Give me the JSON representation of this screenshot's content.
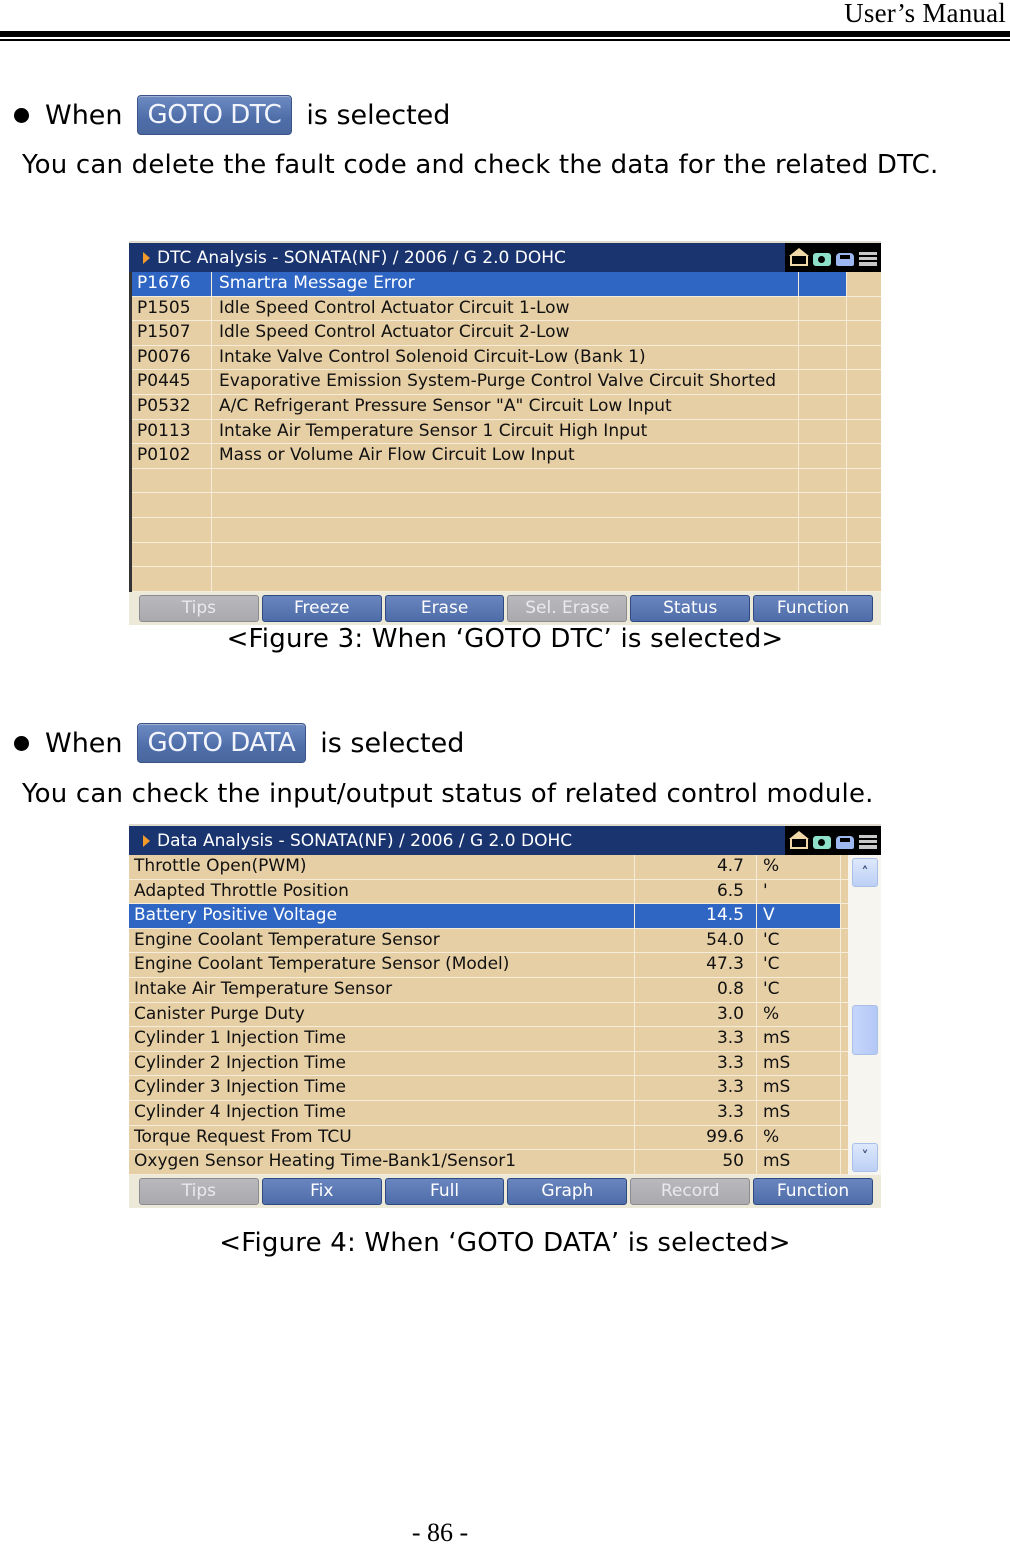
{
  "header": {
    "title": "User’s Manual"
  },
  "section_dtc": {
    "lead_before": "When",
    "button_label": "GOTO DTC",
    "lead_after": "is selected",
    "description": "You can delete the fault code and check the data for the related DTC.",
    "caption": "<Figure 3: When ‘GOTO DTC’ is selected>"
  },
  "dtc_screen": {
    "title": "DTC Analysis - SONATA(NF) / 2006 / G 2.0 DOHC",
    "icons": [
      "home-icon",
      "camera-icon",
      "car-icon",
      "menu-icon"
    ],
    "selected_index": 0,
    "rows": [
      {
        "code": "P1676",
        "description": "Smartra Message Error"
      },
      {
        "code": "P1505",
        "description": "Idle Speed Control Actuator Circuit 1-Low"
      },
      {
        "code": "P1507",
        "description": "Idle Speed Control Actuator Circuit 2-Low"
      },
      {
        "code": "P0076",
        "description": "Intake Valve Control Solenoid Circuit-Low (Bank 1)"
      },
      {
        "code": "P0445",
        "description": "Evaporative Emission System-Purge Control Valve Circuit Shorted"
      },
      {
        "code": "P0532",
        "description": "A/C Refrigerant Pressure Sensor \"A\" Circuit Low Input"
      },
      {
        "code": "P0113",
        "description": "Intake Air Temperature Sensor 1 Circuit High Input"
      },
      {
        "code": "P0102",
        "description": "Mass or Volume Air Flow Circuit Low Input"
      },
      {
        "code": "",
        "description": ""
      },
      {
        "code": "",
        "description": ""
      },
      {
        "code": "",
        "description": ""
      },
      {
        "code": "",
        "description": ""
      },
      {
        "code": "",
        "description": ""
      }
    ],
    "buttons": [
      {
        "label": "Tips",
        "enabled": false
      },
      {
        "label": "Freeze",
        "enabled": true
      },
      {
        "label": "Erase",
        "enabled": true
      },
      {
        "label": "Sel. Erase",
        "enabled": false
      },
      {
        "label": "Status",
        "enabled": true
      },
      {
        "label": "Function",
        "enabled": true
      }
    ]
  },
  "section_data": {
    "lead_before": "When",
    "button_label": "GOTO DATA",
    "lead_after": "is selected",
    "description": "You can check the input/output status of related control module.",
    "caption": "<Figure 4: When ‘GOTO DATA’ is selected>"
  },
  "data_screen": {
    "title": "Data Analysis - SONATA(NF) / 2006 / G 2.0 DOHC",
    "icons": [
      "home-icon",
      "camera-icon",
      "car-icon",
      "menu-icon"
    ],
    "selected_index": 2,
    "rows": [
      {
        "name": "Throttle Open(PWM)",
        "value": "4.7",
        "unit": "%"
      },
      {
        "name": "Adapted Throttle Position",
        "value": "6.5",
        "unit": "'"
      },
      {
        "name": "Battery Positive Voltage",
        "value": "14.5",
        "unit": "V"
      },
      {
        "name": "Engine Coolant Temperature Sensor",
        "value": "54.0",
        "unit": "'C"
      },
      {
        "name": "Engine Coolant Temperature Sensor (Model)",
        "value": "47.3",
        "unit": "'C"
      },
      {
        "name": "Intake Air Temperature Sensor",
        "value": "0.8",
        "unit": "'C"
      },
      {
        "name": "Canister Purge Duty",
        "value": "3.0",
        "unit": "%"
      },
      {
        "name": "Cylinder 1 Injection Time",
        "value": "3.3",
        "unit": "mS"
      },
      {
        "name": "Cylinder 2 Injection Time",
        "value": "3.3",
        "unit": "mS"
      },
      {
        "name": "Cylinder 3 Injection Time",
        "value": "3.3",
        "unit": "mS"
      },
      {
        "name": "Cylinder 4 Injection Time",
        "value": "3.3",
        "unit": "mS"
      },
      {
        "name": "Torque Request From TCU",
        "value": "99.6",
        "unit": "%"
      },
      {
        "name": "Oxygen Sensor Heating Time-Bank1/Sensor1",
        "value": "50",
        "unit": "mS"
      }
    ],
    "scroll_position": 0.55,
    "buttons": [
      {
        "label": "Tips",
        "enabled": false
      },
      {
        "label": "Fix",
        "enabled": true
      },
      {
        "label": "Full",
        "enabled": true
      },
      {
        "label": "Graph",
        "enabled": true
      },
      {
        "label": "Record",
        "enabled": false
      },
      {
        "label": "Function",
        "enabled": true
      }
    ]
  },
  "footer": {
    "page_number": "- 86 -"
  }
}
